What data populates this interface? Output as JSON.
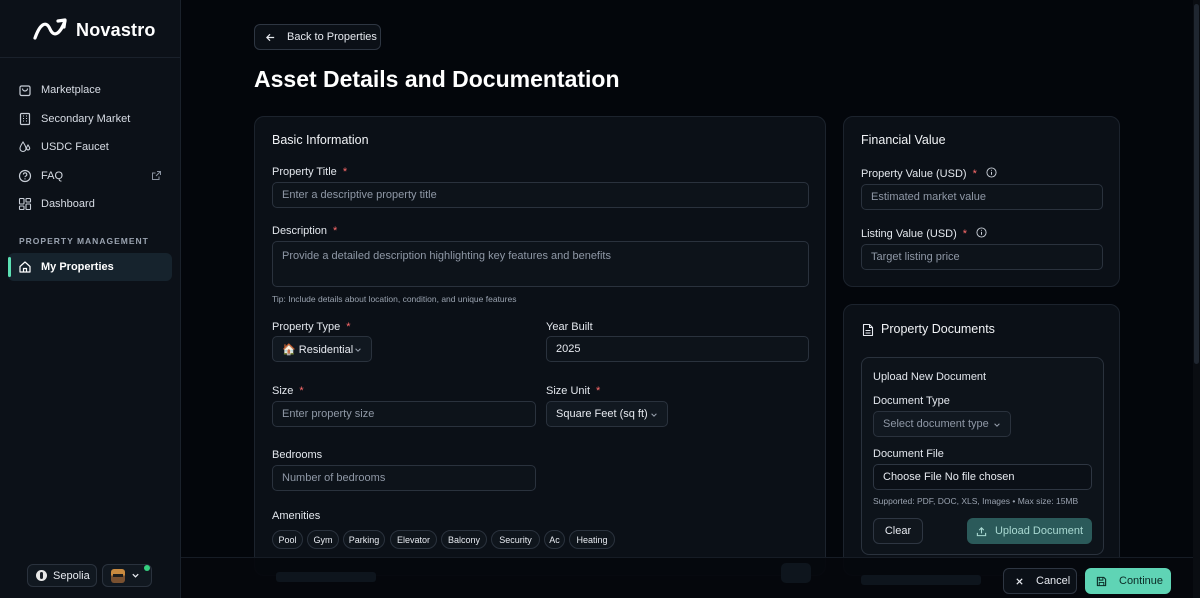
{
  "brand": {
    "name": "Novastro"
  },
  "sidebar": {
    "items": [
      {
        "label": "Marketplace",
        "icon": "shopping-bag-icon"
      },
      {
        "label": "Secondary Market",
        "icon": "building-icon"
      },
      {
        "label": "USDC Faucet",
        "icon": "droplets-icon"
      },
      {
        "label": "FAQ",
        "icon": "help-circle-icon"
      },
      {
        "label": "Dashboard",
        "icon": "dashboard-grid-icon"
      }
    ],
    "section_label": "PROPERTY MANAGEMENT",
    "active_item": {
      "label": "My Properties",
      "icon": "home-icon"
    },
    "network": "Sepolia"
  },
  "header": {
    "back_label": "Back to Properties",
    "title": "Asset Details and Documentation"
  },
  "basic": {
    "title": "Basic Information",
    "property_title_label": "Property Title",
    "property_title_placeholder": "Enter a descriptive property title",
    "description_label": "Description",
    "description_placeholder": "Provide a detailed description highlighting key features and benefits",
    "tip": "Tip: Include details about location, condition, and unique features",
    "property_type_label": "Property Type",
    "property_type_value": "🏠 Residential",
    "year_built_label": "Year Built",
    "year_built_value": "2025",
    "size_label": "Size",
    "size_placeholder": "Enter property size",
    "size_unit_label": "Size Unit",
    "size_unit_value": "Square Feet (sq ft)",
    "bedrooms_label": "Bedrooms",
    "bedrooms_placeholder": "Number of bedrooms",
    "amenities_label": "Amenities",
    "amenities": [
      "Pool",
      "Gym",
      "Parking",
      "Elevator",
      "Balcony",
      "Security",
      "Ac",
      "Heating"
    ]
  },
  "financial": {
    "title": "Financial Value",
    "property_value_label": "Property Value (USD)",
    "property_value_placeholder": "Estimated market value",
    "listing_value_label": "Listing Value (USD)",
    "listing_value_placeholder": "Target listing price"
  },
  "documents": {
    "title": "Property Documents",
    "upload_title": "Upload New Document",
    "document_type_label": "Document Type",
    "document_type_placeholder": "Select document type",
    "document_file_label": "Document File",
    "file_input_text": "Choose File No file chosen",
    "supported": "Supported: PDF, DOC, XLS, Images • Max size: 15MB",
    "clear_label": "Clear",
    "upload_label": "Upload Document"
  },
  "footer": {
    "cancel_label": "Cancel",
    "continue_label": "Continue"
  },
  "colors": {
    "accent": "#5fd4b5",
    "required": "#ff6b6b",
    "background": "#03060b"
  }
}
